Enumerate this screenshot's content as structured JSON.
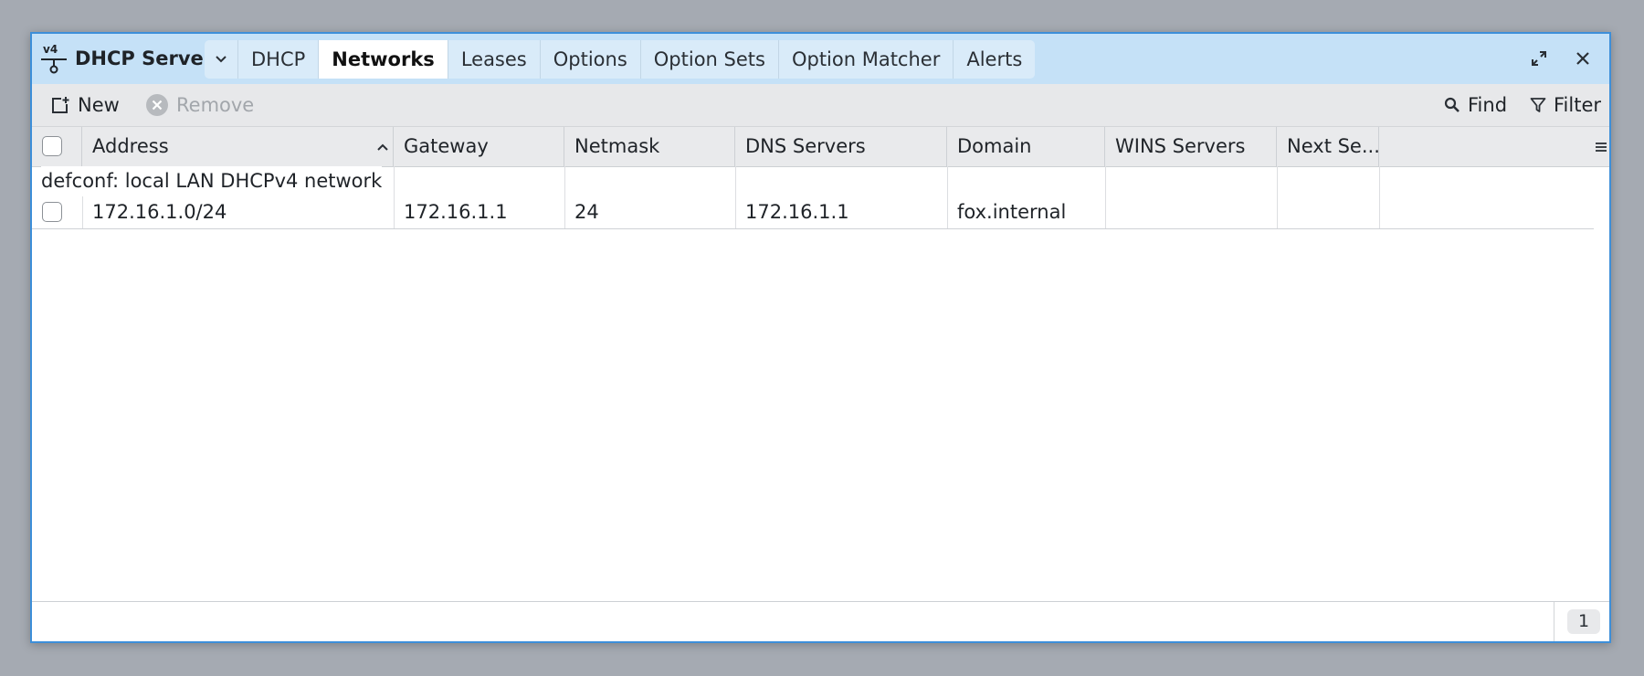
{
  "window": {
    "app_title": "DHCP Server",
    "app_icon": "v4-network-icon",
    "tabs": [
      {
        "label": "DHCP",
        "active": false
      },
      {
        "label": "Networks",
        "active": true
      },
      {
        "label": "Leases",
        "active": false
      },
      {
        "label": "Options",
        "active": false
      },
      {
        "label": "Option Sets",
        "active": false
      },
      {
        "label": "Option Matcher",
        "active": false
      },
      {
        "label": "Alerts",
        "active": false
      }
    ],
    "buttons": [
      "expand-icon",
      "close-icon"
    ]
  },
  "toolbar": {
    "new_label": "New",
    "remove_label": "Remove",
    "find_label": "Find",
    "filter_label": "Filter"
  },
  "table": {
    "columns": [
      "Address",
      "Gateway",
      "Netmask",
      "DNS Servers",
      "Domain",
      "WINS Servers",
      "Next Se..."
    ],
    "sorted_column": "Address",
    "sort_direction": "ascending",
    "group_label": "defconf: local LAN DHCPv4 network",
    "rows": [
      {
        "address": "172.16.1.0/24",
        "gateway": "172.16.1.1",
        "netmask": "24",
        "dns_servers": "172.16.1.1",
        "domain": "fox.internal",
        "wins_servers": "",
        "next_server": ""
      }
    ]
  },
  "footer": {
    "count": "1"
  },
  "colors": {
    "titlebar": "#c5e1f7",
    "window_border": "#3d8fd9",
    "toolbar": "#e7e8ea"
  }
}
